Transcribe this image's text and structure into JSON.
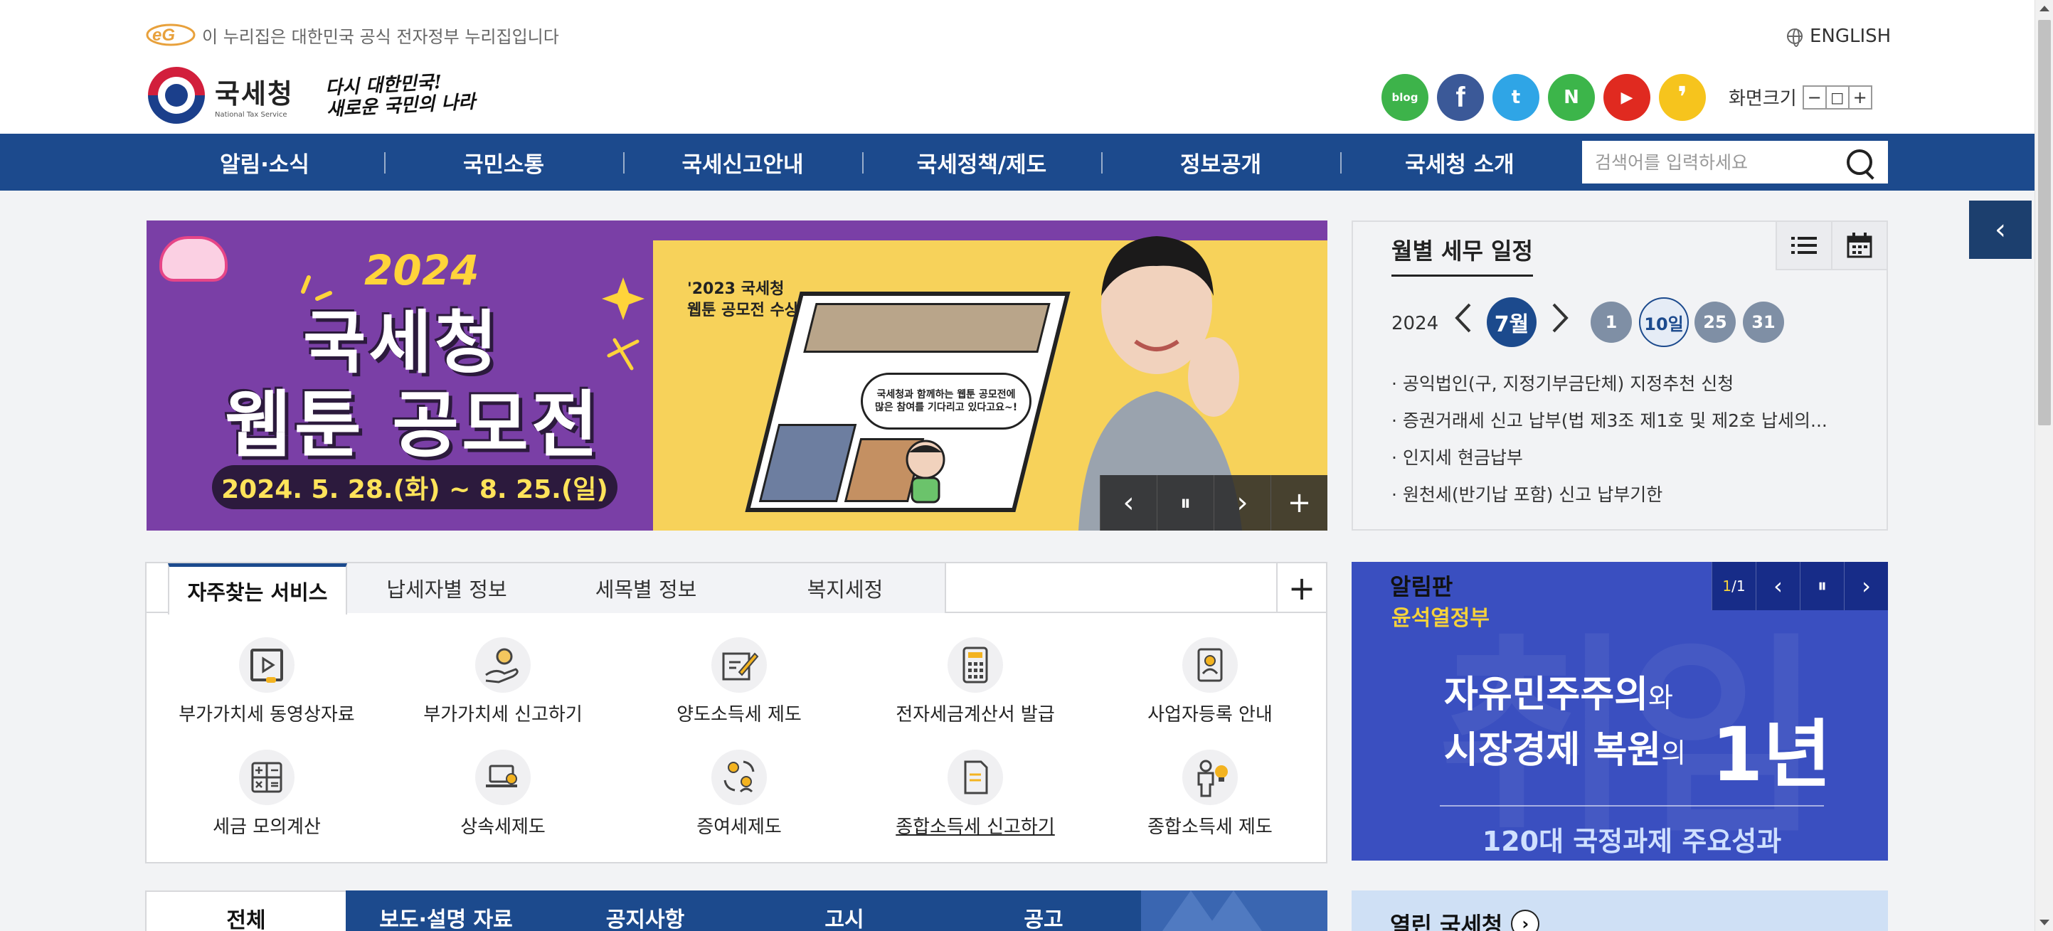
{
  "header": {
    "gov_notice": "이 누리집은 대한민국 공식 전자정부 누리집입니다",
    "english_label": "ENGLISH",
    "logo_text": "국세청",
    "logo_sub": "National Tax Service",
    "slogan_line1": "다시 대한민국!",
    "slogan_line2": "새로운 국민의 나라",
    "font_size_label": "화면크기",
    "font_minus": "−",
    "font_reset": "□",
    "font_plus": "+"
  },
  "social": [
    {
      "name": "blog",
      "label": "blog",
      "color": "#3db34a"
    },
    {
      "name": "facebook",
      "label": "f",
      "color": "#3b5998"
    },
    {
      "name": "twitter",
      "label": "t",
      "color": "#2fa5e6"
    },
    {
      "name": "naver-post",
      "label": "N",
      "color": "#3cb54a"
    },
    {
      "name": "youtube",
      "label": "▶",
      "color": "#e02a20"
    },
    {
      "name": "kakao",
      "label": "❜",
      "color": "#f6c41d"
    }
  ],
  "nav": {
    "items": [
      "알림·소식",
      "국민소통",
      "국세신고안내",
      "국세정책/제도",
      "정보공개",
      "국세청 소개"
    ],
    "search_placeholder": "검색어를 입력하세요"
  },
  "banner": {
    "year": "2024",
    "title1": "국세청",
    "title2": "웹툰 공모전",
    "date": "2024. 5. 28.(화) ~ 8. 25.(일)",
    "award_line1": "'2023 국세청",
    "award_line2": "웹툰 공모전 수상작'",
    "bubble": "국세청과 함께하는 웹툰 공모전에 많은 참여를 기다리고 있다고요~!",
    "controls": [
      "‹",
      "⏸",
      "›",
      "+"
    ]
  },
  "schedule": {
    "title": "월별 세무 일정",
    "year": "2024",
    "month": "7월",
    "days": [
      "1",
      "10일",
      "25",
      "31"
    ],
    "active_day_index": 1,
    "items": [
      "· 공익법인(구, 지정기부금단체) 지정추천 신청",
      "· 증권거래세 신고 납부(법 제3조 제1호 및 제2호 납세의...",
      "· 인지세 현금납부",
      "· 원천세(반기납 포함) 신고 납부기한"
    ]
  },
  "services": {
    "tabs": [
      "자주찾는 서비스",
      "납세자별 정보",
      "세목별 정보",
      "복지세정"
    ],
    "more": "+",
    "items": [
      {
        "label": "부가가치세 동영상자료",
        "icon": "video-icon"
      },
      {
        "label": "부가가치세 신고하기",
        "icon": "hand-person-icon"
      },
      {
        "label": "양도소득세 제도",
        "icon": "document-pen-icon"
      },
      {
        "label": "전자세금계산서 발급",
        "icon": "calculator-icon"
      },
      {
        "label": "사업자등록 안내",
        "icon": "id-card-icon"
      },
      {
        "label": "세금 모의계산",
        "icon": "math-icon"
      },
      {
        "label": "상속세제도",
        "icon": "laptop-search-icon"
      },
      {
        "label": "증여세제도",
        "icon": "exchange-people-icon"
      },
      {
        "label": "종합소득세 신고하기",
        "icon": "document-icon"
      },
      {
        "label": "종합소득세 제도",
        "icon": "person-bulb-icon"
      }
    ]
  },
  "notice": {
    "title": "알림판",
    "page_current": "1",
    "page_total": "1",
    "sub": "윤석열정부",
    "line1a": "자유민주주의",
    "line1b": "와",
    "line2a": "시장경제 복원",
    "line2b": "의",
    "big": "1년",
    "bottom": "120대 국정과제 주요성과",
    "bg_text": "취임"
  },
  "news": {
    "tabs": [
      "전체",
      "보도·설명 자료",
      "공지사항",
      "고시",
      "공고"
    ]
  },
  "opengov": {
    "title": "열린 국세청",
    "arrow": "›"
  },
  "side_toggle": "‹"
}
